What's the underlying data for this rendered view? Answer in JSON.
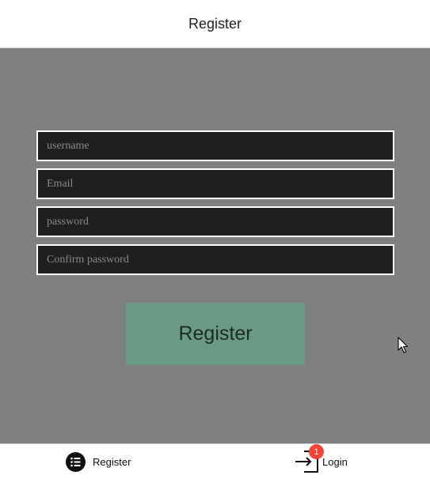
{
  "header": {
    "title": "Register"
  },
  "form": {
    "username_placeholder": "username",
    "email_placeholder": "Email",
    "password_placeholder": "password",
    "confirm_placeholder": "Confirm password",
    "submit_label": "Register"
  },
  "bottom_nav": {
    "items": [
      {
        "label": "Register",
        "icon": "list-icon"
      },
      {
        "label": "Login",
        "icon": "login-icon",
        "badge": "1"
      }
    ]
  },
  "colors": {
    "background": "#808080",
    "field_background": "#1f1f1f",
    "button_background": "#6a9a86",
    "badge": "#f44336"
  }
}
